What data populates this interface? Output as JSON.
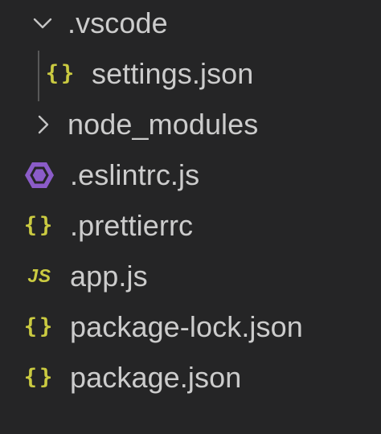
{
  "explorer": {
    "items": [
      {
        "label": ".vscode",
        "kind": "folder",
        "expanded": true,
        "icon": "chevron-down-icon"
      },
      {
        "label": "settings.json",
        "kind": "file",
        "icon": "json-braces-icon",
        "icon_glyph": "{}",
        "icon_color": "#cbcb41"
      },
      {
        "label": "node_modules",
        "kind": "folder",
        "expanded": false,
        "icon": "chevron-right-icon"
      },
      {
        "label": ".eslintrc.js",
        "kind": "file",
        "icon": "eslint-hexagon-icon",
        "icon_color": "#8b5cc8"
      },
      {
        "label": ".prettierrc",
        "kind": "file",
        "icon": "json-braces-icon",
        "icon_glyph": "{}",
        "icon_color": "#cbcb41"
      },
      {
        "label": "app.js",
        "kind": "file",
        "icon": "javascript-js-icon",
        "icon_glyph": "JS",
        "icon_color": "#cbcb41"
      },
      {
        "label": "package-lock.json",
        "kind": "file",
        "icon": "json-braces-icon",
        "icon_glyph": "{}",
        "icon_color": "#cbcb41"
      },
      {
        "label": "package.json",
        "kind": "file",
        "icon": "json-braces-icon",
        "icon_glyph": "{}",
        "icon_color": "#cbcb41"
      }
    ]
  },
  "colors": {
    "background": "#252526",
    "text": "#cccccc",
    "chevron": "#c5c5c5",
    "json_icon": "#cbcb41",
    "js_icon": "#cbcb41",
    "eslint_icon": "#8b5cc8",
    "indent_guide": "#585858"
  }
}
